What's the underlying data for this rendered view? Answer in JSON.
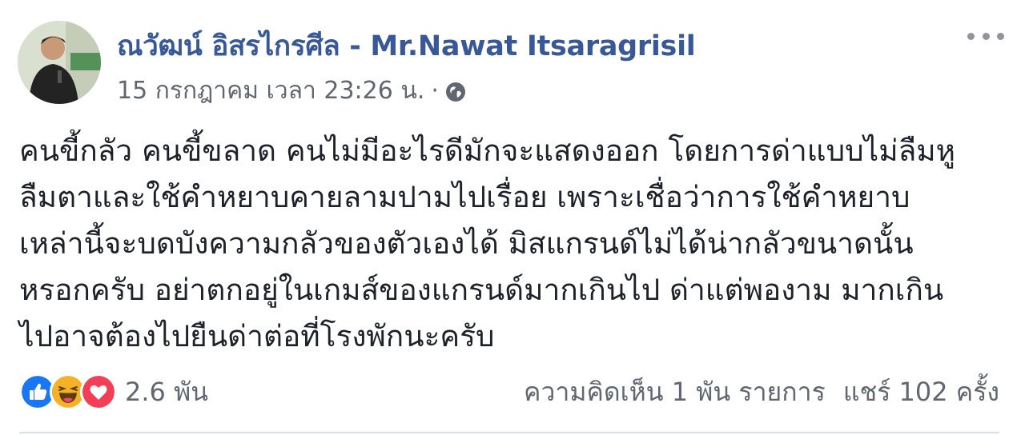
{
  "post": {
    "author_name": "ณวัฒน์ อิสรไกรศีล - Mr.Nawat Itsaragrisil",
    "timestamp": "15 กรกฎาคม เวลา 23:26 น.",
    "separator": "·",
    "audience_icon": "globe-icon",
    "more_icon": "more-horizontal-icon",
    "body_lines": [
      "คนขี้กลัว คนขี้ขลาด คนไม่มีอะไรดีมักจะแสดงออก โดยการด่าแบบไม่ลืมหู",
      "ลืมตาและใช้คำหยาบคายลามปามไปเรื่อย เพราะเชื่อว่าการใช้คำหยาบ",
      "เหล่านี้จะบดบังความกลัวของตัวเองได้ มิสแกรนด์ไม่ได้น่ากลัวขนาดนั้น",
      "หรอกครับ อย่าตกอยู่ในเกมส์ของแกรนด์มากเกินไป ด่าแต่พองาม มากเกิน",
      "ไปอาจต้องไปยืนด่าต่อที่โรงพักนะครับ"
    ]
  },
  "reactions": {
    "icons": [
      "like-icon",
      "haha-icon",
      "love-icon"
    ],
    "count": "2.6 พัน",
    "colors": {
      "like": "#1877f2",
      "haha": "#f7b125",
      "love": "#f33e58"
    }
  },
  "stats": {
    "comments": "ความคิดเห็น 1 พัน รายการ",
    "shares": "แชร์ 102 ครั้ง"
  },
  "colors": {
    "author": "#385898",
    "meta": "#616770",
    "text": "#1d2129",
    "divider": "#dadde1"
  }
}
